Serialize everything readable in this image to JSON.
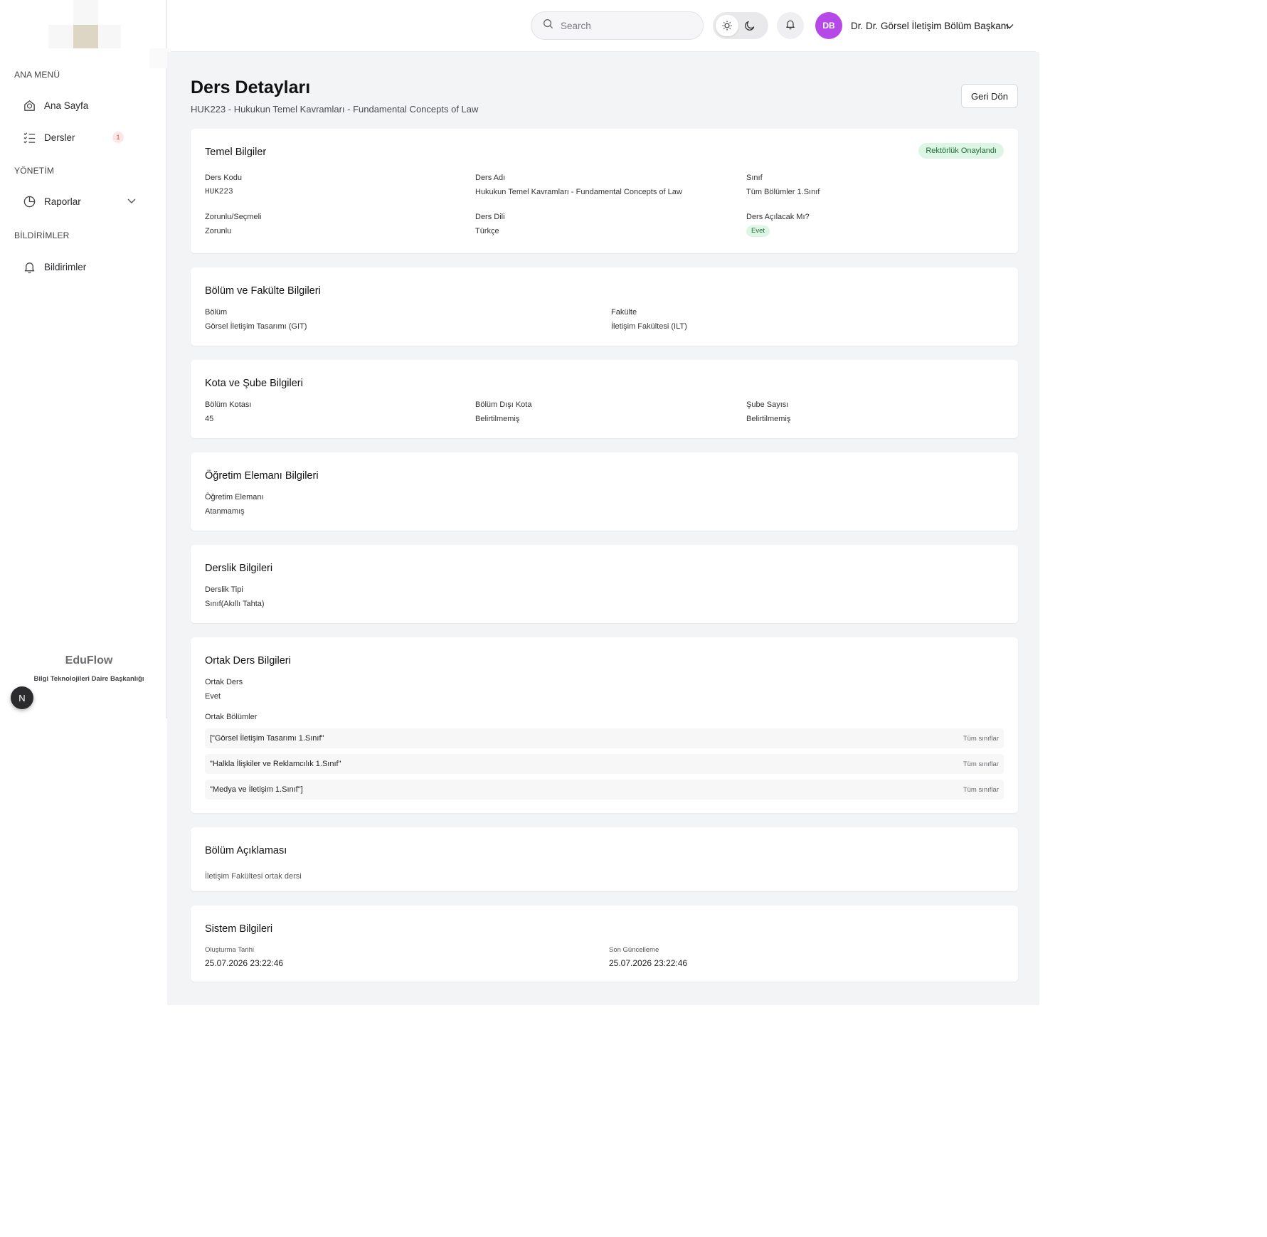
{
  "sidebar": {
    "sections": [
      {
        "title": "ANA MENÜ"
      },
      {
        "title": "YÖNETİM"
      },
      {
        "title": "BİLDİRİMLER"
      }
    ],
    "items": [
      {
        "label": "Ana Sayfa",
        "icon": "home-icon"
      },
      {
        "label": "Dersler",
        "icon": "checklist-icon",
        "badge": "1"
      },
      {
        "label": "Raporlar",
        "icon": "pie-chart-icon"
      },
      {
        "label": "Bildirimler",
        "icon": "bell-icon"
      }
    ],
    "brand": {
      "name": "EduFlow",
      "subtitle": "Bilgi Teknolojileri Daire Başkanlığı"
    },
    "n_button": "N"
  },
  "header": {
    "search_placeholder": "Search",
    "avatar_initials": "DB",
    "user_name": "Dr. Dr. Görsel İletişim Bölüm Başkanı",
    "avatar_color": "#b548e6"
  },
  "page": {
    "title": "Ders Detayları",
    "subtitle": "HUK223 - Hukukun Temel Kavramları - Fundamental Concepts of Law",
    "back_label": "Geri Dön"
  },
  "basic": {
    "title": "Temel Bilgiler",
    "status": "Rektörlük Onaylandı",
    "code_label": "Ders Kodu",
    "code": "HUK223",
    "name_label": "Ders Adı",
    "name": "Hukukun Temel Kavramları - Fundamental Concepts of Law",
    "class_label": "Sınıf",
    "class": "Tüm Bölümler 1.Sınıf",
    "type_label": "Zorunlu/Seçmeli",
    "type": "Zorunlu",
    "lang_label": "Ders Dili",
    "lang": "Türkçe",
    "open_label": "Ders Açılacak Mı?",
    "open": "Evet"
  },
  "department": {
    "title": "Bölüm ve Fakülte Bilgileri",
    "dept_label": "Bölüm",
    "dept": "Görsel İletişim Tasarımı (GIT)",
    "faculty_label": "Fakülte",
    "faculty": "İletişim Fakültesi (ILT)"
  },
  "quota": {
    "title": "Kota ve Şube Bilgileri",
    "dept_quota_label": "Bölüm Kotası",
    "dept_quota": "45",
    "outside_quota_label": "Bölüm Dışı Kota",
    "outside_quota": "Belirtilmemiş",
    "branch_label": "Şube Sayısı",
    "branch": "Belirtilmemiş"
  },
  "instructor": {
    "title": "Öğretim Elemanı Bilgileri",
    "label": "Öğretim Elemanı",
    "value": "Atanmamış"
  },
  "classroom": {
    "title": "Derslik Bilgileri",
    "label": "Derslik Tipi",
    "value": "Sınıf(Akıllı Tahta)"
  },
  "common": {
    "title": "Ortak Ders Bilgileri",
    "label": "Ortak Ders",
    "value": "Evet",
    "depts_label": "Ortak Bölümler",
    "rows": [
      {
        "name": "[\"Görsel İletişim Tasarımı 1.Sınıf\"",
        "scope": "Tüm sınıflar"
      },
      {
        "name": "\"Halkla İlişkiler ve Reklamcılık 1.Sınıf\"",
        "scope": "Tüm sınıflar"
      },
      {
        "name": "\"Medya ve İletişim 1.Sınıf\"]",
        "scope": "Tüm sınıflar"
      }
    ]
  },
  "description": {
    "title": "Bölüm Açıklaması",
    "text": "İletişim Fakültesi ortak dersi"
  },
  "system": {
    "title": "Sistem Bilgileri",
    "created_label": "Oluşturma Tarihi",
    "created": "25.07.2026 23:22:46",
    "updated_label": "Son Güncelleme",
    "updated": "25.07.2026 23:22:46"
  }
}
